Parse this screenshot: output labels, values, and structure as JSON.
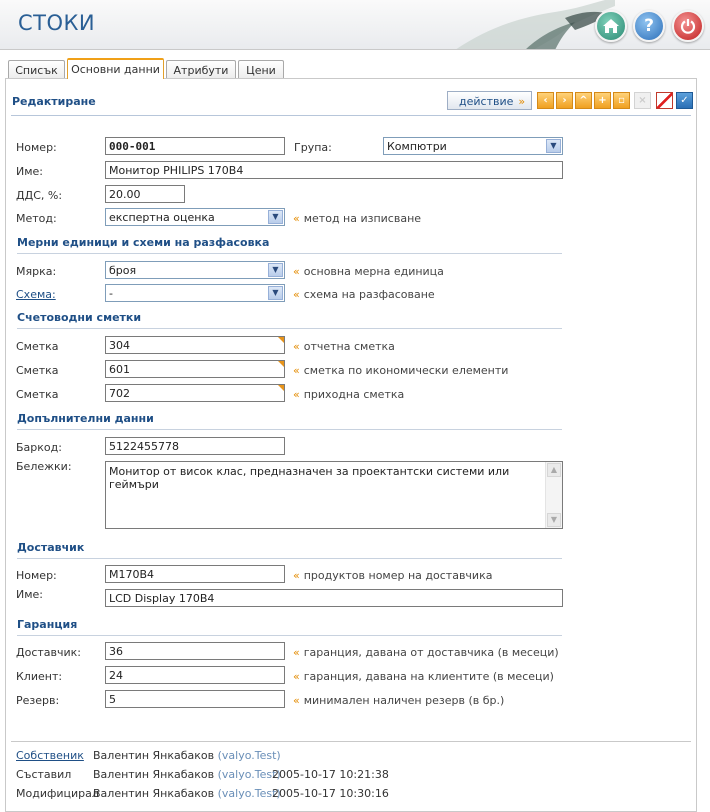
{
  "header": {
    "title": "СТОКИ"
  },
  "tabs": [
    "Списък",
    "Основни данни",
    "Атрибути",
    "Цени"
  ],
  "toolbar": {
    "section_title": "Редактиране",
    "action_label": "действие"
  },
  "basic": {
    "number_label": "Номер:",
    "number_value": "000-001",
    "group_label": "Група:",
    "group_value": "Компютри",
    "name_label": "Име:",
    "name_value": "Монитор PHILIPS 170B4",
    "vat_label": "ДДС, %:",
    "vat_value": "20.00",
    "method_label": "Метод:",
    "method_value": "експертна оценка",
    "method_hint": "метод на изписване"
  },
  "units": {
    "title": "Мерни единици и схеми на разфасовка",
    "measure_label": "Мярка:",
    "measure_value": "броя",
    "measure_hint": "основна мерна единица",
    "scheme_label": "Схема:",
    "scheme_value": "-",
    "scheme_hint": "схема на разфасоване"
  },
  "accounts": {
    "title": "Счетоводни сметки",
    "rows": [
      {
        "label": "Сметка",
        "value": "304",
        "hint": "отчетна сметка"
      },
      {
        "label": "Сметка",
        "value": "601",
        "hint": "сметка по икономически елементи"
      },
      {
        "label": "Сметка",
        "value": "702",
        "hint": "приходна сметка"
      }
    ]
  },
  "extra": {
    "title": "Допълнителни данни",
    "barcode_label": "Баркод:",
    "barcode_value": "5122455778",
    "notes_label": "Бележки:",
    "notes_value": "Монитор от висок клас, предназначен за проектантски системи или геймъри"
  },
  "supplier": {
    "title": "Доставчик",
    "number_label": "Номер:",
    "number_value": "M170B4",
    "number_hint": "продуктов номер на доставчика",
    "name_label": "Име:",
    "name_value": "LCD Display 170B4"
  },
  "warranty": {
    "title": "Гаранция",
    "supplier_label": "Доставчик:",
    "supplier_value": "36",
    "supplier_hint": "гаранция, давана от доставчика (в месеци)",
    "client_label": "Клиент:",
    "client_value": "24",
    "client_hint": "гаранция, давана на клиентите (в месеци)",
    "reserve_label": "Резерв:",
    "reserve_value": "5",
    "reserve_hint": "минимален наличен резерв (в бр.)"
  },
  "footer": {
    "owner_label": "Собственик",
    "owner_name": "Валентин Янкабаков",
    "owner_user": "(valyo.Test)",
    "created_label": "Съставил",
    "created_name": "Валентин Янкабаков",
    "created_user": "(valyo.Test)",
    "created_date": "2005-10-17 10:21:38",
    "modified_label": "Модифицирал",
    "modified_name": "Валентин Янкабаков",
    "modified_user": "(valyo.Test)",
    "modified_date": "2005-10-17 10:30:16"
  }
}
